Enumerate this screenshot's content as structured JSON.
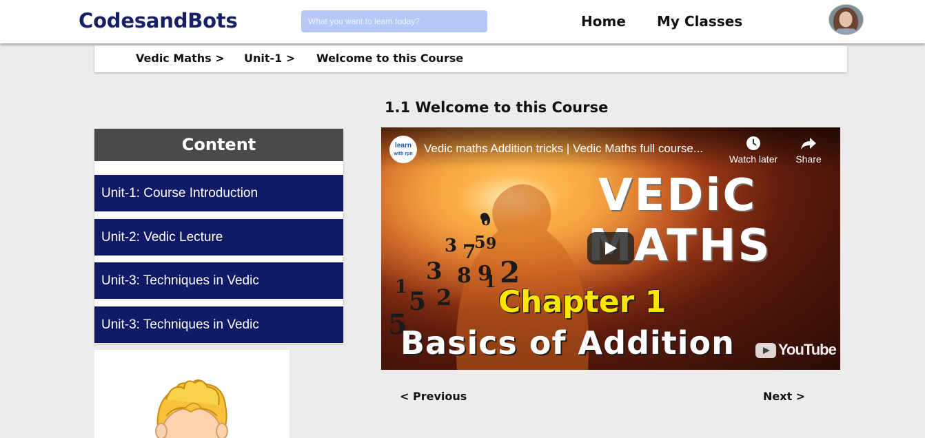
{
  "header": {
    "brand": "CodesandBots",
    "search_placeholder": "What you want to learn today?",
    "nav": [
      "Home",
      "My Classes"
    ],
    "avatar_icon": "user-avatar-icon"
  },
  "breadcrumb": [
    "Vedic Maths >",
    "Unit-1 >",
    "Welcome to this Course"
  ],
  "sidebar": {
    "title": "Content",
    "units": [
      "Unit-1: Course Introduction",
      "Unit-2: Vedic Lecture",
      "Unit-3: Techniques in Vedic",
      "Unit-3: Techniques in Vedic"
    ]
  },
  "lesson": {
    "title": "1.1 Welcome to this Course",
    "video": {
      "channel_logo_line1": "learn",
      "channel_logo_line2": "with rpn",
      "title": "Vedic maths Addition tricks | Vedic Maths full course...",
      "watch_later": "Watch later",
      "share": "Share",
      "thumb_line1": "VEDiC",
      "thumb_line2": "MATHS",
      "thumb_line3": "Chapter 1",
      "thumb_line4": "Basics of Addition",
      "youtube_label": "YouTube"
    }
  },
  "pager": {
    "previous": "< Previous",
    "next": "Next >"
  },
  "colors": {
    "brand": "#152067",
    "unit_bg": "#101a66",
    "sidebar_head_bg": "#4a4a4a",
    "search_bg": "#b5c8f7",
    "page_bg": "#edeceb"
  }
}
